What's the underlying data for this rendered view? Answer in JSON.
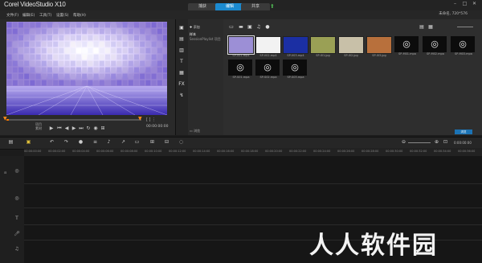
{
  "app": {
    "logo": "Corel VideoStudio X10"
  },
  "menu": [
    "文件(F)",
    "编辑(E)",
    "工具(T)",
    "设置(S)",
    "帮助(H)"
  ],
  "tabs": [
    {
      "label": "捕获",
      "active": false
    },
    {
      "label": "编辑",
      "active": true
    },
    {
      "label": "共享",
      "active": false
    }
  ],
  "project_info": "未命名, 720*576",
  "preview": {
    "mode_labels": [
      "项目",
      "素材"
    ],
    "timecode": "00:00:00:00",
    "side_timecode": "00:00:00:00"
  },
  "library": {
    "folders": [
      {
        "label": "添加"
      },
      {
        "label": "样本"
      },
      {
        "label": "SessionPlaylist 项目"
      }
    ],
    "thumbs": [
      {
        "label": "SP-V01.mp4",
        "kind": "image",
        "color": "#9c8fd6"
      },
      {
        "label": "SP-V02.mp4",
        "kind": "image",
        "color": "#f2f2f2"
      },
      {
        "label": "SP-V03.mp4",
        "kind": "image",
        "color": "#1b2fa3"
      },
      {
        "label": "SP-I01.jpg",
        "kind": "image",
        "color": "#9aa055"
      },
      {
        "label": "SP-I02.jpg",
        "kind": "image",
        "color": "#c8c0a8"
      },
      {
        "label": "SP-I03.jpg",
        "kind": "image",
        "color": "#b8703c"
      },
      {
        "label": "SP-M01.mpa",
        "kind": "audio"
      },
      {
        "label": "SP-M02.mpa",
        "kind": "audio"
      },
      {
        "label": "SP-M03.mpa",
        "kind": "audio"
      },
      {
        "label": "SP-S01.mpa",
        "kind": "audio"
      },
      {
        "label": "SP-S02.mpa",
        "kind": "audio"
      },
      {
        "label": "SP-S03.mpa",
        "kind": "audio"
      }
    ],
    "browse_label": "浏览",
    "status": "浏览"
  },
  "timeline": {
    "ticks": [
      "00:00:00:00",
      "00:00:02:00",
      "00:00:04:00",
      "00:00:06:00",
      "00:00:08:00",
      "00:00:10:00",
      "00:00:12:00",
      "00:00:14:00",
      "00:00:16:00",
      "00:00:18:00",
      "00:00:20:00",
      "00:00:22:00",
      "00:00:24:00",
      "00:00:26:00",
      "00:00:28:00",
      "00:00:30:00",
      "00:00:32:00",
      "00:00:34:00",
      "00:00:36:00"
    ],
    "duration": "0:00:00:00"
  },
  "watermark": "人人软件园",
  "colors": {
    "accent": "#1b8ad0",
    "scrubber": "#ff7a00",
    "upload_icon": "#4caf50"
  }
}
